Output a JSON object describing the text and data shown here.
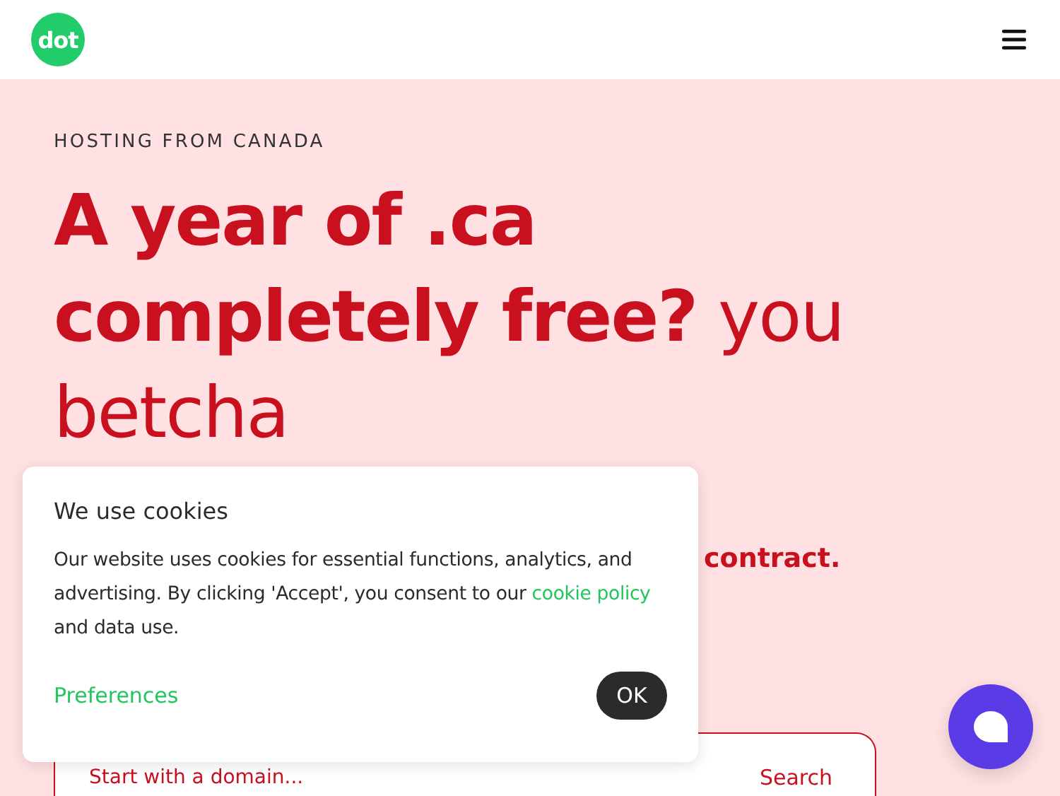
{
  "header": {
    "logo": "dot"
  },
  "hero": {
    "eyebrow": "HOSTING FROM CANADA",
    "headline": "**A year of .ca completely free?** you betcha",
    "subline": "contract.",
    "search": {
      "placeholder": "Start with a domain...",
      "button": "Search"
    }
  },
  "cookie_banner": {
    "title": "We use cookies",
    "text_before": "Our website uses cookies for essential functions, analytics, and advertising. By clicking 'Accept', you consent to our ",
    "link": "cookie policy",
    "text_after": " and data use.",
    "preferences": "Preferences",
    "ok": "OK"
  }
}
